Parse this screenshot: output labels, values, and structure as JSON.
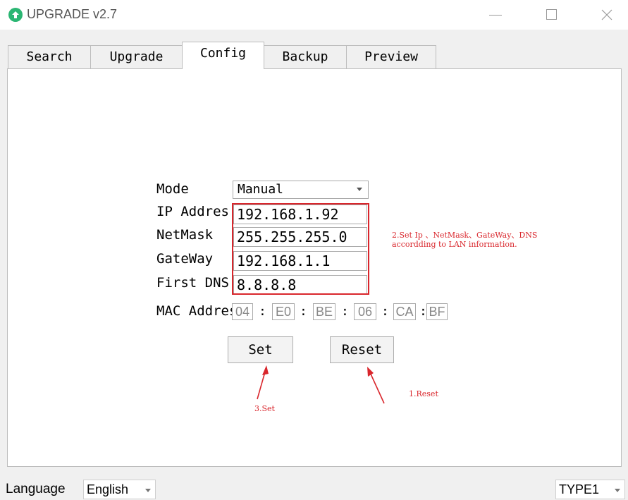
{
  "window": {
    "title": "UPGRADE v2.7",
    "icon": "upgrade-arrow-icon",
    "accent_color": "#2bb673"
  },
  "tabs": [
    {
      "label": "Search",
      "active": false
    },
    {
      "label": "Upgrade",
      "active": false
    },
    {
      "label": "Config",
      "active": true
    },
    {
      "label": "Backup",
      "active": false
    },
    {
      "label": "Preview",
      "active": false
    }
  ],
  "form": {
    "mode_label": "Mode",
    "mode_value": "Manual",
    "ip_label": "IP Address",
    "ip_value": "192.168.1.92",
    "netmask_label": "NetMask",
    "netmask_value": "255.255.255.0",
    "gateway_label": "GateWay",
    "gateway_value": "192.168.1.1",
    "dns_label": "First DNS",
    "dns_value": "8.8.8.8",
    "mac_label": "MAC Address",
    "mac_parts": [
      "04",
      "E0",
      "BE",
      "06",
      "CA",
      "BF"
    ],
    "mac_separator": ":"
  },
  "buttons": {
    "set": "Set",
    "reset": "Reset"
  },
  "annotations": {
    "note_fields_line1": "2.Set Ip 、NetMask、GateWay、DNS",
    "note_fields_line2": "accordding to LAN information.",
    "note_reset": "1.Reset",
    "note_set": "3.Set",
    "highlight_color": "#d9262c"
  },
  "footer": {
    "language_label": "Language",
    "language_value": "English",
    "type_value": "TYPE1"
  }
}
